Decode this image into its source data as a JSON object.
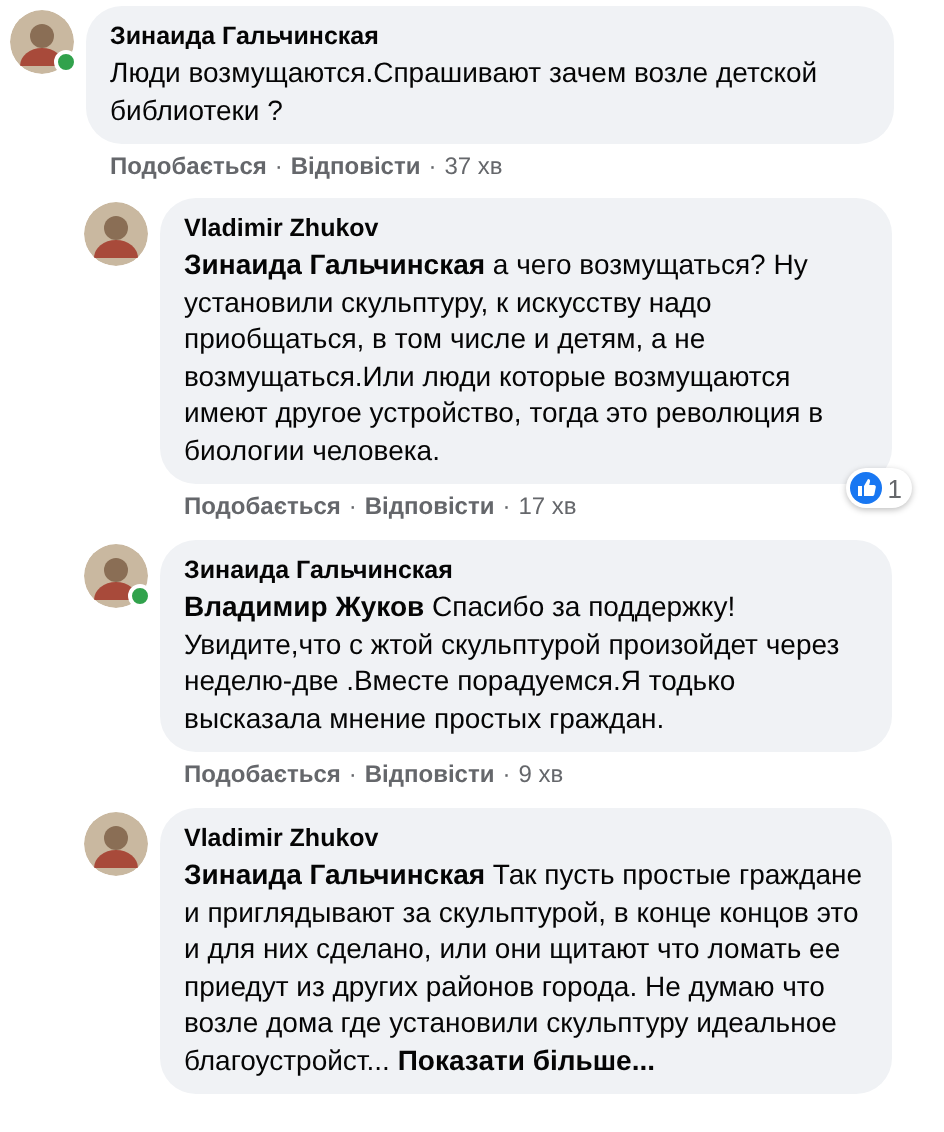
{
  "separator": "·",
  "comments": [
    {
      "author": "Зинаида Гальчинская",
      "online": true,
      "text": "Люди возмущаются.Спрашивают зачем возле детской библиотеки ?",
      "like": "Подобається",
      "reply": "Відповісти",
      "time": "37 хв",
      "children": [
        {
          "author": "Vladimir Zhukov",
          "online": false,
          "text": "**Зинаида Гальчинская** а чего возмущаться? Ну установили скульптуру, к искусству надо приобщаться, в том числе и детям, а не возмущаться.Или люди которые возмущаются имеют другое устройство, тогда это революция в биологии человека.",
          "like": "Подобається",
          "reply": "Відповісти",
          "time": "17 хв",
          "reactions": "1"
        },
        {
          "author": "Зинаида Гальчинская",
          "online": true,
          "text": "**Владимир Жуков** Спасибо за поддержку! Увидите,что с жтой скульптурой произойдет через неделю-две .Вместе порадуемся.Я тодько высказала мнение простых граждан.",
          "like": "Подобається",
          "reply": "Відповісти",
          "time": "9 хв"
        },
        {
          "author": "Vladimir Zhukov",
          "online": false,
          "text": "**Зинаида Гальчинская** Так пусть простые граждане и приглядывают за скульптурой, в конце концов это и для них сделано, или они щитают что ломать ее приедут из других районов города. Не думаю что возле дома где установили скульптуру идеальное благоустройст...",
          "see_more": "Показати більше..."
        }
      ]
    }
  ]
}
